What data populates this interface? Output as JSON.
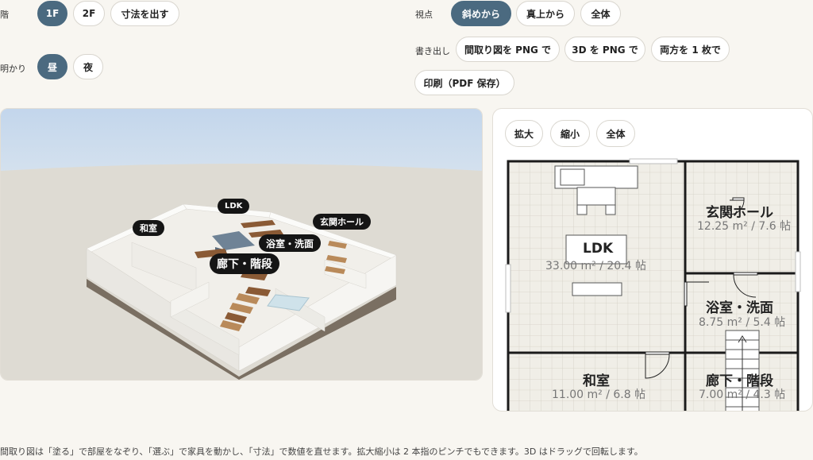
{
  "controls": {
    "floor_label": "階",
    "floor_1": "1F",
    "floor_2": "2F",
    "dimensions_button": "寸法を出す",
    "light_label": "明かり",
    "light_day": "昼",
    "light_night": "夜",
    "view_label": "視点",
    "view_oblique": "斜めから",
    "view_top": "真上から",
    "view_all": "全体",
    "export_label": "書き出し",
    "export_plan_png": "間取り図を PNG で",
    "export_3d_png": "3D を PNG で",
    "export_both": "両方を 1 枚で",
    "print_pdf": "印刷（PDF 保存）"
  },
  "view3d": {
    "tags": {
      "ldk": "LDK",
      "washitsu": "和室",
      "genkan": "玄関ホール",
      "yokushitsu": "浴室・洗面",
      "rouka": "廊下・階段"
    }
  },
  "plan": {
    "zoom_in": "拡大",
    "zoom_out": "縮小",
    "fit": "全体",
    "rooms": {
      "ldk": {
        "name": "LDK",
        "area": "33.00 m² / 20.4 帖"
      },
      "genkan": {
        "name": "玄関ホール",
        "area": "12.25 m² / 7.6 帖"
      },
      "yokushitsu": {
        "name": "浴室・洗面",
        "area": "8.75 m² / 5.4 帖"
      },
      "washitsu": {
        "name": "和室",
        "area": "11.00 m² / 6.8 帖"
      },
      "rouka": {
        "name": "廊下・階段",
        "area": "7.00 m² / 4.3 帖"
      }
    }
  },
  "footer": {
    "hint": "間取り図は「塗る」で部屋をなぞり、「選ぶ」で家具を動かし、「寸法」で数値を直せます。拡大縮小は 2 本指のピンチでもできます。3D はドラッグで回転します。"
  },
  "colors": {
    "accent": "#4b6a80",
    "page_bg": "#f8f6f1"
  }
}
